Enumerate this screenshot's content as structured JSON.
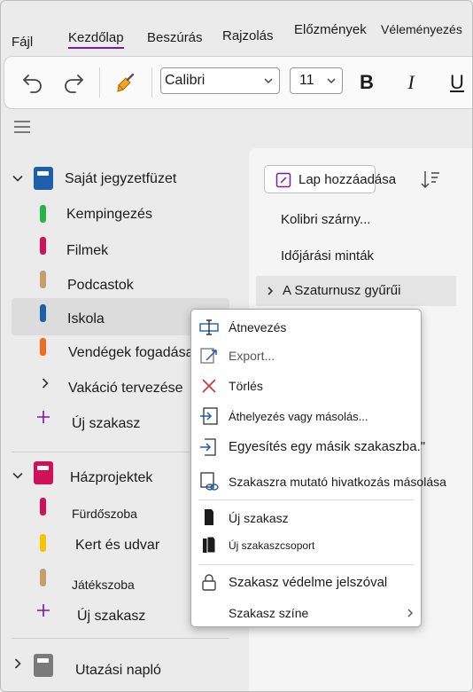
{
  "ribbon": {
    "tabs": [
      {
        "label": "Fájl"
      },
      {
        "label": "Kezdőlap"
      },
      {
        "label": "Beszúrás"
      },
      {
        "label": "Rajzolás"
      },
      {
        "label": "Előzmények"
      },
      {
        "label": "Véleményezés"
      }
    ]
  },
  "toolbar": {
    "font_name": "Calibri",
    "font_size": "11",
    "bold": "B",
    "italic": "I",
    "underline": "U"
  },
  "nav": {
    "notebook1": {
      "label": "Saját jegyzetfüzet",
      "color": "#1f5fa8"
    },
    "sections1": [
      {
        "label": "Kempingezés",
        "color": "#2bb34a"
      },
      {
        "label": "Filmek",
        "color": "#d0115a"
      },
      {
        "label": "Podcastok",
        "color": "#c5a06c"
      },
      {
        "label": "Iskola",
        "color": "#1f5fa8"
      },
      {
        "label": "Vendégek fogadása",
        "color": "#f26a1b"
      }
    ],
    "group1": {
      "label": "Vakáció tervezése"
    },
    "new_section1": "Új szakasz",
    "notebook2": {
      "label": "Házprojektek",
      "color": "#d0115a"
    },
    "sections2": [
      {
        "label": "Fürdőszoba",
        "color": "#d0115a"
      },
      {
        "label": "Kert és udvar",
        "color": "#f7c400"
      },
      {
        "label": "Játékszoba",
        "color": "#c5a06c"
      }
    ],
    "new_section2": "Új szakasz",
    "notebook3": {
      "label": "Utazási napló",
      "color": "#7a7a7a"
    }
  },
  "pages": {
    "add_page": "Lap hozzáadása",
    "items": [
      {
        "label": "Kolibri szárny..."
      },
      {
        "label": "Időjárási minták"
      },
      {
        "label": "A Szaturnusz gyűrűi"
      }
    ]
  },
  "context_menu": {
    "items": [
      {
        "label": "Átnevezés"
      },
      {
        "label": "Export..."
      },
      {
        "label": "Törlés"
      },
      {
        "label": "Áthelyezés vagy másolás..."
      },
      {
        "label": "Egyesítés egy másik szakaszba.\""
      },
      {
        "label": "Szakaszra mutató hivatkozás másolása"
      },
      {
        "label": "Új szakasz"
      },
      {
        "label": "Új szakaszcsoport"
      },
      {
        "label": "Szakasz védelme jelszóval"
      },
      {
        "label": "Szakasz színe"
      }
    ]
  }
}
